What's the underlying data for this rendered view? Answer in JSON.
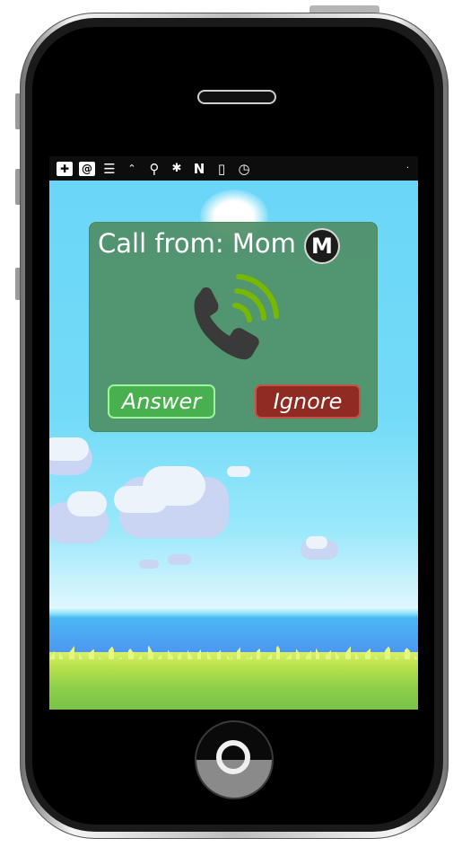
{
  "status_bar": {
    "icons": [
      "add-icon",
      "at-sign-icon",
      "notes-icon",
      "signal-icon",
      "location-pin-icon",
      "bluetooth-icon",
      "nfc-icon",
      "phone-vibrate-icon",
      "alarm-clock-icon"
    ]
  },
  "call_dialog": {
    "title": "Call from: Mom",
    "caller_initial": "M",
    "answer_label": "Answer",
    "ignore_label": "Ignore"
  },
  "colors": {
    "dialog": "#508f66",
    "answer_button": "#48b04e",
    "ignore_button": "#8f2b22",
    "sky": "#6fd8f6",
    "grass": "#8ed04a",
    "sea": "#4d8ff2",
    "phone_handset": "#3a3a3a",
    "signal_waves": "#78b800"
  }
}
